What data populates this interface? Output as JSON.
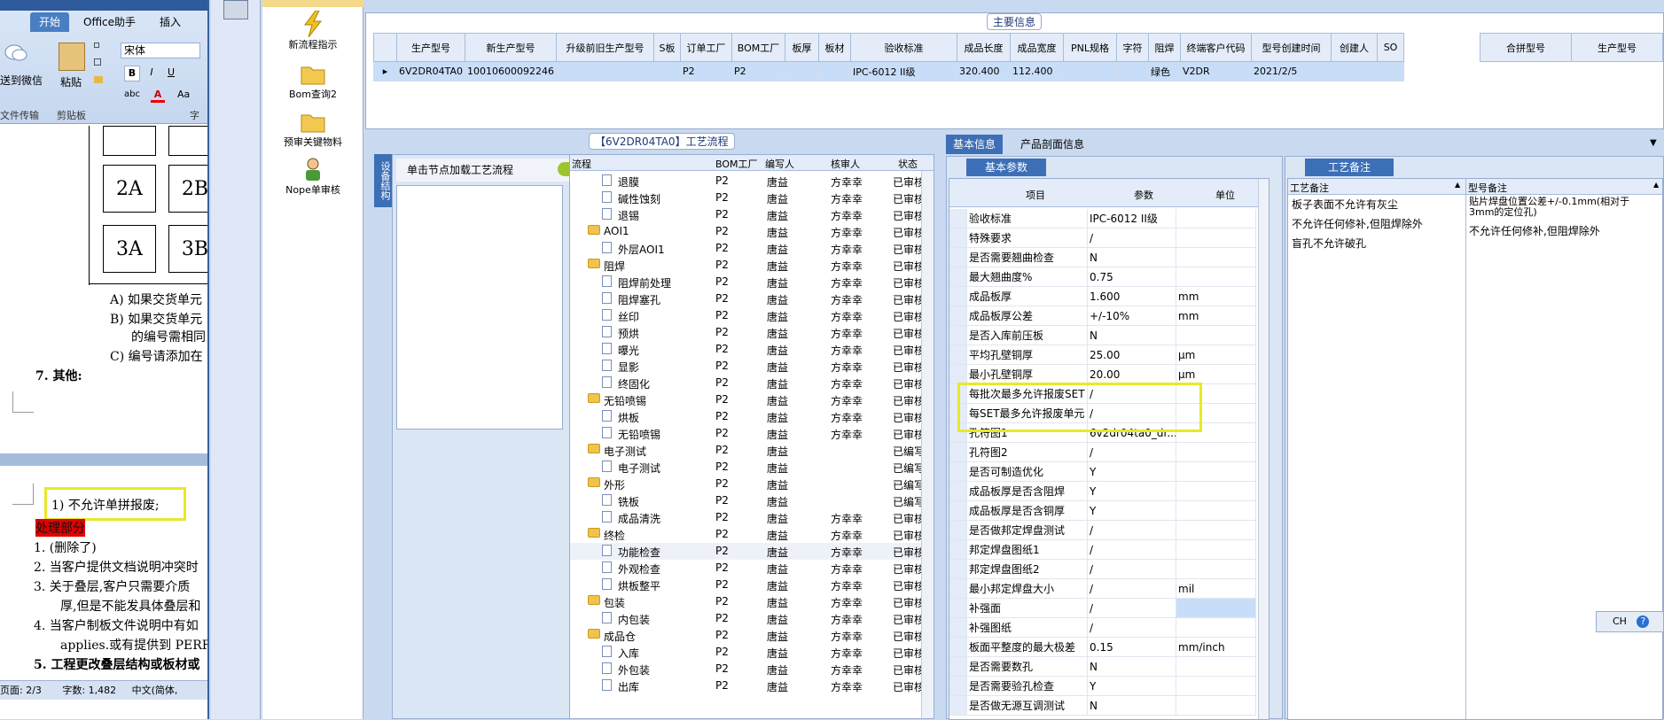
{
  "word": {
    "tabs": [
      "开始",
      "Office助手",
      "插入"
    ],
    "font_name": "宋体",
    "paste_label": "粘贴",
    "send_wechat": "送到微信",
    "groups": [
      "文件传输",
      "剪贴板",
      "字"
    ],
    "format_buttons": [
      "B",
      "I",
      "U",
      "abc",
      "Aa"
    ],
    "cells": [
      "2A",
      "2B",
      "3A",
      "3B"
    ],
    "lines": [
      "A) 如果交货单元",
      "B) 如果交货单元",
      "的编号需相同",
      "C) 编号请添加在",
      "7.  其他:",
      "1) 不允许单拼报废;",
      "处理部分",
      "1.  (删除了)",
      "2.  当客户提供文档说明冲突时",
      "3.  关于叠层,客户只需要介质",
      "厚,但是不能发具体叠层和",
      "4.  当客户制板文件说明中有如",
      "applies.或有提供到 PERFA",
      "5.  工程更改叠层结构或板材或"
    ],
    "status": {
      "page": "页面: 2/3",
      "words": "字数: 1,482",
      "lang": "中文(简体,"
    }
  },
  "nav": {
    "items": [
      "新流程指示",
      "Bom查询2",
      "预审关键物料",
      "Nope单审核"
    ]
  },
  "main_info": {
    "title": "主要信息",
    "columns": [
      "生产型号",
      "新生产型号",
      "升级前旧生产型号",
      "S板",
      "订单工厂",
      "BOM工厂",
      "板厚",
      "板材",
      "验收标准",
      "成品长度",
      "成品宽度",
      "PNL规格",
      "字符",
      "阻焊",
      "终端客户代码",
      "型号创建时间",
      "创建人",
      "SO"
    ],
    "row": [
      "6V2DR04TA0",
      "10010600092246",
      "",
      "",
      "P2",
      "P2",
      "",
      "",
      "IPC-6012 II级",
      "320.400",
      "112.400",
      "",
      "",
      "绿色",
      "V2DR",
      "2021/2/5",
      "",
      ""
    ],
    "side_columns": [
      "合拼型号",
      "生产型号"
    ]
  },
  "flow": {
    "title": "【6V2DR04TA0】工艺流程",
    "vertical_tab": "设备结构",
    "load_button": "单击节点加载工艺流程",
    "columns": [
      "流程",
      "BOM工厂",
      "编写人",
      "核审人",
      "状态"
    ],
    "rows": [
      {
        "level": 2,
        "type": "doc",
        "name": "退膜",
        "bom": "P2",
        "author": "唐益",
        "reviewer": "方幸幸",
        "status": "已审核"
      },
      {
        "level": 2,
        "type": "doc",
        "name": "碱性蚀刻",
        "bom": "P2",
        "author": "唐益",
        "reviewer": "方幸幸",
        "status": "已审核"
      },
      {
        "level": 2,
        "type": "doc",
        "name": "退锡",
        "bom": "P2",
        "author": "唐益",
        "reviewer": "方幸幸",
        "status": "已审核"
      },
      {
        "level": 1,
        "type": "folder",
        "name": "AOI1",
        "bom": "P2",
        "author": "唐益",
        "reviewer": "方幸幸",
        "status": "已审核"
      },
      {
        "level": 2,
        "type": "doc",
        "name": "外层AOI1",
        "bom": "P2",
        "author": "唐益",
        "reviewer": "方幸幸",
        "status": "已审核"
      },
      {
        "level": 1,
        "type": "folder",
        "name": "阻焊",
        "bom": "P2",
        "author": "唐益",
        "reviewer": "方幸幸",
        "status": "已审核"
      },
      {
        "level": 2,
        "type": "doc",
        "name": "阻焊前处理",
        "bom": "P2",
        "author": "唐益",
        "reviewer": "方幸幸",
        "status": "已审核"
      },
      {
        "level": 2,
        "type": "doc",
        "name": "阻焊塞孔",
        "bom": "P2",
        "author": "唐益",
        "reviewer": "方幸幸",
        "status": "已审核"
      },
      {
        "level": 2,
        "type": "doc",
        "name": "丝印",
        "bom": "P2",
        "author": "唐益",
        "reviewer": "方幸幸",
        "status": "已审核"
      },
      {
        "level": 2,
        "type": "doc",
        "name": "预烘",
        "bom": "P2",
        "author": "唐益",
        "reviewer": "方幸幸",
        "status": "已审核"
      },
      {
        "level": 2,
        "type": "doc",
        "name": "曝光",
        "bom": "P2",
        "author": "唐益",
        "reviewer": "方幸幸",
        "status": "已审核"
      },
      {
        "level": 2,
        "type": "doc",
        "name": "显影",
        "bom": "P2",
        "author": "唐益",
        "reviewer": "方幸幸",
        "status": "已审核"
      },
      {
        "level": 2,
        "type": "doc",
        "name": "终固化",
        "bom": "P2",
        "author": "唐益",
        "reviewer": "方幸幸",
        "status": "已审核"
      },
      {
        "level": 1,
        "type": "folder",
        "name": "无铅喷锡",
        "bom": "P2",
        "author": "唐益",
        "reviewer": "方幸幸",
        "status": "已审核"
      },
      {
        "level": 2,
        "type": "doc",
        "name": "烘板",
        "bom": "P2",
        "author": "唐益",
        "reviewer": "方幸幸",
        "status": "已审核"
      },
      {
        "level": 2,
        "type": "doc",
        "name": "无铅喷锡",
        "bom": "P2",
        "author": "唐益",
        "reviewer": "方幸幸",
        "status": "已审核"
      },
      {
        "level": 1,
        "type": "folder",
        "name": "电子测试",
        "bom": "P2",
        "author": "唐益",
        "reviewer": "",
        "status": "已编写"
      },
      {
        "level": 2,
        "type": "doc",
        "name": "电子测试",
        "bom": "P2",
        "author": "唐益",
        "reviewer": "",
        "status": "已编写"
      },
      {
        "level": 1,
        "type": "folder",
        "name": "外形",
        "bom": "P2",
        "author": "唐益",
        "reviewer": "",
        "status": "已编写"
      },
      {
        "level": 2,
        "type": "doc",
        "name": "铣板",
        "bom": "P2",
        "author": "唐益",
        "reviewer": "",
        "status": "已编写"
      },
      {
        "level": 2,
        "type": "doc",
        "name": "成品清洗",
        "bom": "P2",
        "author": "唐益",
        "reviewer": "方幸幸",
        "status": "已审核"
      },
      {
        "level": 1,
        "type": "folder",
        "name": "终检",
        "bom": "P2",
        "author": "唐益",
        "reviewer": "方幸幸",
        "status": "已审核"
      },
      {
        "level": 2,
        "type": "doc",
        "name": "功能检查",
        "bom": "P2",
        "author": "唐益",
        "reviewer": "方幸幸",
        "status": "已审核"
      },
      {
        "level": 2,
        "type": "doc",
        "name": "外观检查",
        "bom": "P2",
        "author": "唐益",
        "reviewer": "方幸幸",
        "status": "已审核"
      },
      {
        "level": 2,
        "type": "doc",
        "name": "烘板整平",
        "bom": "P2",
        "author": "唐益",
        "reviewer": "方幸幸",
        "status": "已审核"
      },
      {
        "level": 1,
        "type": "folder",
        "name": "包装",
        "bom": "P2",
        "author": "唐益",
        "reviewer": "方幸幸",
        "status": "已审核"
      },
      {
        "level": 2,
        "type": "doc",
        "name": "内包装",
        "bom": "P2",
        "author": "唐益",
        "reviewer": "方幸幸",
        "status": "已审核"
      },
      {
        "level": 1,
        "type": "folder",
        "name": "成品仓",
        "bom": "P2",
        "author": "唐益",
        "reviewer": "方幸幸",
        "status": "已审核"
      },
      {
        "level": 2,
        "type": "doc",
        "name": "入库",
        "bom": "P2",
        "author": "唐益",
        "reviewer": "方幸幸",
        "status": "已审核"
      },
      {
        "level": 2,
        "type": "doc",
        "name": "外包装",
        "bom": "P2",
        "author": "唐益",
        "reviewer": "方幸幸",
        "status": "已审核"
      },
      {
        "level": 2,
        "type": "doc",
        "name": "出库",
        "bom": "P2",
        "author": "唐益",
        "reviewer": "方幸幸",
        "status": "已审核"
      }
    ]
  },
  "right": {
    "tabs": [
      "基本信息",
      "产品剖面信息"
    ],
    "params_title": "基本参数",
    "params_columns": [
      "项目",
      "参数",
      "单位"
    ],
    "params": [
      [
        "验收标准",
        "IPC-6012 II级",
        ""
      ],
      [
        "特殊要求",
        "/",
        ""
      ],
      [
        "是否需要翘曲检查",
        "N",
        ""
      ],
      [
        "最大翘曲度%",
        "0.75",
        ""
      ],
      [
        "成品板厚",
        "1.600",
        "mm"
      ],
      [
        "成品板厚公差",
        "+/-10%",
        "mm"
      ],
      [
        "是否入库前压板",
        "N",
        ""
      ],
      [
        "平均孔壁铜厚",
        "25.00",
        "μm"
      ],
      [
        "最小孔壁铜厚",
        "20.00",
        "μm"
      ],
      [
        "每批次最多允许报废SET",
        "/",
        ""
      ],
      [
        "每SET最多允许报废单元",
        "/",
        ""
      ],
      [
        "孔符图1",
        "6v2dr04ta0_dr...",
        ""
      ],
      [
        "孔符图2",
        "/",
        ""
      ],
      [
        "是否可制造优化",
        "Y",
        ""
      ],
      [
        "成品板厚是否含阻焊",
        "Y",
        ""
      ],
      [
        "成品板厚是否含铜厚",
        "Y",
        ""
      ],
      [
        "是否做邦定焊盘测试",
        "/",
        ""
      ],
      [
        "邦定焊盘图纸1",
        "/",
        ""
      ],
      [
        "邦定焊盘图纸2",
        "/",
        ""
      ],
      [
        "最小邦定焊盘大小",
        "/",
        "mil"
      ],
      [
        "补强面",
        "/",
        ""
      ],
      [
        "补强图纸",
        "/",
        ""
      ],
      [
        "板面平整度的最大极差",
        "0.15",
        "mm/inch"
      ],
      [
        "是否需要数孔",
        "N",
        ""
      ],
      [
        "是否需要验孔检查",
        "Y",
        ""
      ],
      [
        "是否做无源互调测试",
        "N",
        ""
      ]
    ],
    "notes_title": "工艺备注",
    "notes_columns": [
      "工艺备注",
      "型号备注"
    ],
    "process_notes": [
      "板子表面不允许有灰尘",
      "不允许任何修补,但阻焊除外",
      "盲孔不允许破孔"
    ],
    "model_notes": [
      "贴片焊盘位置公差+/-0.1mm(相对于3mm的定位孔)",
      "不允许任何修补,但阻焊除外"
    ]
  },
  "ime": {
    "lang": "CH",
    "help": "?"
  },
  "colors": {
    "highlight": "#e8e82a",
    "select": "#c8def8",
    "accent": "#3d6fb6"
  }
}
